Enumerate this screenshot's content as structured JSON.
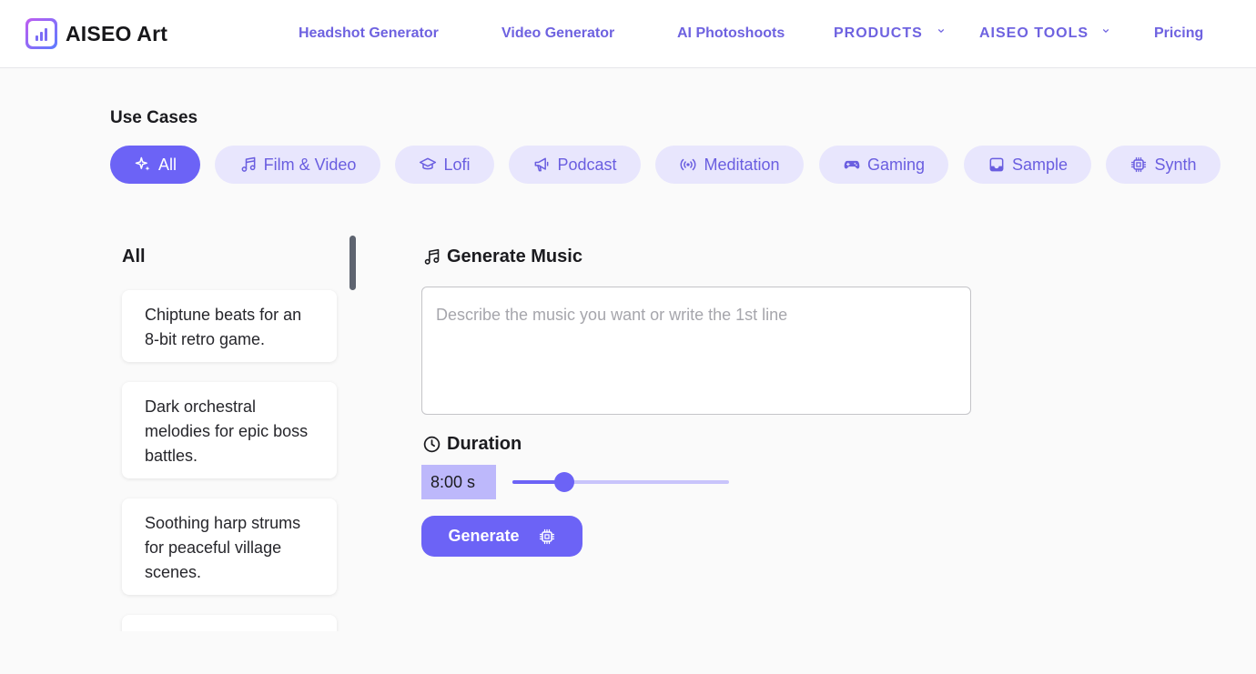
{
  "header": {
    "logo_text": "AISEO Art",
    "nav": [
      {
        "label": "Headshot Generator"
      },
      {
        "label": "Video Generator"
      },
      {
        "label": "AI Photoshoots"
      },
      {
        "label": "PRODUCTS",
        "dropdown": true
      },
      {
        "label": "AISEO TOOLS",
        "dropdown": true
      },
      {
        "label": "Pricing"
      }
    ]
  },
  "use_cases": {
    "title": "Use Cases",
    "pills": [
      {
        "label": "All",
        "icon": "sparkles-icon",
        "active": true
      },
      {
        "label": "Film & Video",
        "icon": "music-note-icon"
      },
      {
        "label": "Lofi",
        "icon": "graduation-cap-icon"
      },
      {
        "label": "Podcast",
        "icon": "megaphone-icon"
      },
      {
        "label": "Meditation",
        "icon": "broadcast-icon"
      },
      {
        "label": "Gaming",
        "icon": "gamepad-icon"
      },
      {
        "label": "Sample",
        "icon": "inbox-icon"
      },
      {
        "label": "Synth",
        "icon": "chip-icon"
      }
    ]
  },
  "sidebar": {
    "title": "All",
    "items": [
      {
        "text": "Chiptune beats for an 8-bit retro game."
      },
      {
        "text": "Dark orchestral melodies for epic boss battles."
      },
      {
        "text": "Soothing harp strums for peaceful village scenes."
      },
      {
        "text": ""
      }
    ]
  },
  "generator": {
    "title": "Generate Music",
    "title_icon": "music-note-icon",
    "prompt_placeholder": "Describe the music you want or write the 1st line",
    "prompt_value": "",
    "duration_label": "Duration",
    "duration_icon": "clock-icon",
    "duration_value": "8:00 s",
    "duration_slider_fraction": 0.24,
    "generate_label": "Generate",
    "generate_icon": "chip-icon"
  },
  "colors": {
    "accent": "#6c63f6",
    "pill_bg": "#e8e6fd",
    "pill_text": "#6a5ee0",
    "nav_text": "#6e62e0",
    "duration_bg": "#bdb8fb"
  }
}
